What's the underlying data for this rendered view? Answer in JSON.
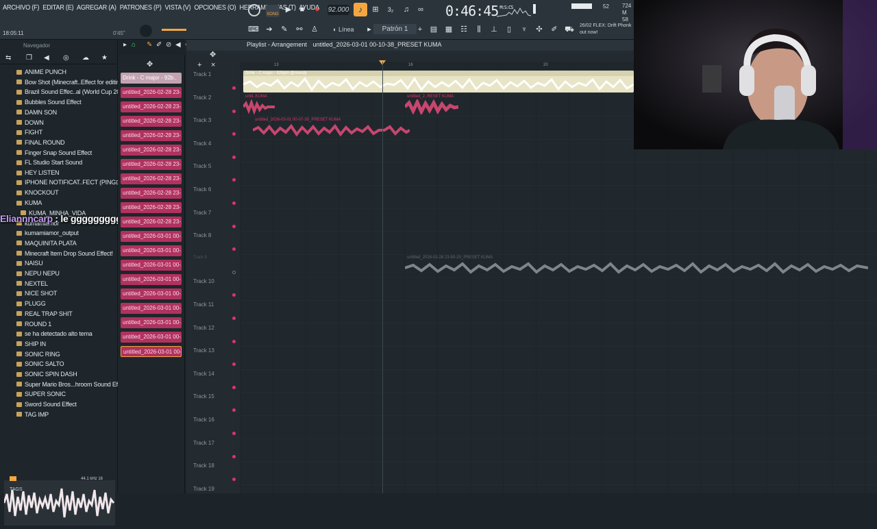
{
  "menu": [
    "ARCHIVO (F)",
    "EDITAR (E)",
    "AGREGAR (A)",
    "PATRONES (P)",
    "VISTA (V)",
    "OPCIONES (O)",
    "HERRAMIENTAS (T)",
    "AYUDA"
  ],
  "transport": {
    "song_label": "SONG",
    "bpm": "92.000",
    "time": "0:46",
    "time_frac": "45",
    "time_unit": "M:S:CS",
    "pattern": "Patrón 1",
    "snap": "Línea"
  },
  "status": {
    "clock": "18:05:11",
    "cpu": "0'45\"",
    "hint": "26/02  FLEX: Drift Phonk out now!",
    "ram": "52",
    "cpu_mem": "724 M\n58"
  },
  "colors": {
    "accent": "#f3a641",
    "clip_pink": "#b1325f",
    "clip_cream": "#e8e4c6"
  },
  "browser": {
    "title": "Navegador",
    "items": [
      "ANIME PUNCH",
      "Bow Shot (Minecraft..Effect for editing",
      "Brazil Sound Effec..al (World Cup 2002)",
      "Bubbles Sound Effect",
      "DAMN SON",
      "DOWN",
      "FIGHT",
      "FINAL ROUND",
      "Finger Snap Sound Effect",
      "FL Studio Start Sound",
      "HEY LISTEN",
      "IPHONE NOTIFICAT..FECT (PING⊡DING)",
      "KNOCKOUT",
      "KUMA",
      "KUMA_MINHA_VIDA",
      "kumamiamor",
      "kumamiamor_output",
      "MAQUINITA PLATA",
      "Minecraft Item Drop Sound Effect!",
      "NAISU",
      "NEPU NEPU",
      "NEXTEL",
      "NICE SHOT",
      "PLUGG",
      "REAL TRAP SHIT",
      "ROUND 1",
      "se ha detectado alto tema",
      "SHIP IN",
      "SONIC RING",
      "SONIC SALTO",
      "SONIC SPIN DASH",
      "Super Mario Bros...hroom Sound Effect",
      "SUPER SONIC",
      "Sword Sound Effect",
      "TAG IMP"
    ],
    "preview_meta": "44.1 kHz 16",
    "tags_label": "TAGS"
  },
  "chat": {
    "user": "Eliannncarp",
    "message": " : le gggggggggobaste"
  },
  "picker": [
    "Drink - C major - 92b..",
    "untitled_2026-02-28 23-..",
    "untitled_2026-02-28 23-..",
    "untitled_2026-02-28 23-..",
    "untitled_2026-02-28 23-..",
    "untitled_2026-02-28 23-..",
    "untitled_2026-02-28 23-..",
    "untitled_2026-02-28 23-..",
    "untitled_2026-02-28 23-..",
    "untitled_2026-02-28 23-..",
    "untitled_2026-02-28 23-..",
    "untitled_2026-03-01 00-..",
    "untitled_2026-03-01 00-..",
    "untitled_2026-03-01 00-..",
    "untitled_2026-03-01 00-..",
    "untitled_2026-03-01 00-..",
    "untitled_2026-03-01 00-..",
    "untitled_2026-03-01 00-..",
    "untitled_2026-03-01 00-..",
    "untitled_2026-03-01 00-.."
  ],
  "playlist": {
    "title": "Playlist - Arrangement",
    "file": "untitled_2026-03-01 00-10-38_PRESET KUMA",
    "ruler": [
      "13",
      "16",
      "20"
    ],
    "tracks": [
      "Track 1",
      "Track 2",
      "Track 3",
      "Track 4",
      "Track 5",
      "Track 6",
      "Track 7",
      "Track 8",
      "Track 9",
      "Track 10",
      "Track 11",
      "Track 12",
      "Track 13",
      "Track 14",
      "Track 15",
      "Track 16",
      "Track 17",
      "Track 18",
      "Track 19"
    ],
    "clips": {
      "c1": "Drink - C major - 92bpm @moody",
      "c2a": "untit..KUMA",
      "c2b": "untitled_2..RESET KUMA",
      "c3": "untitled_2026-03-01 00-07-35_PRESET KUMA",
      "c9": "untitled_2026-02-28 23-50-20_PRESET KUMA"
    }
  }
}
